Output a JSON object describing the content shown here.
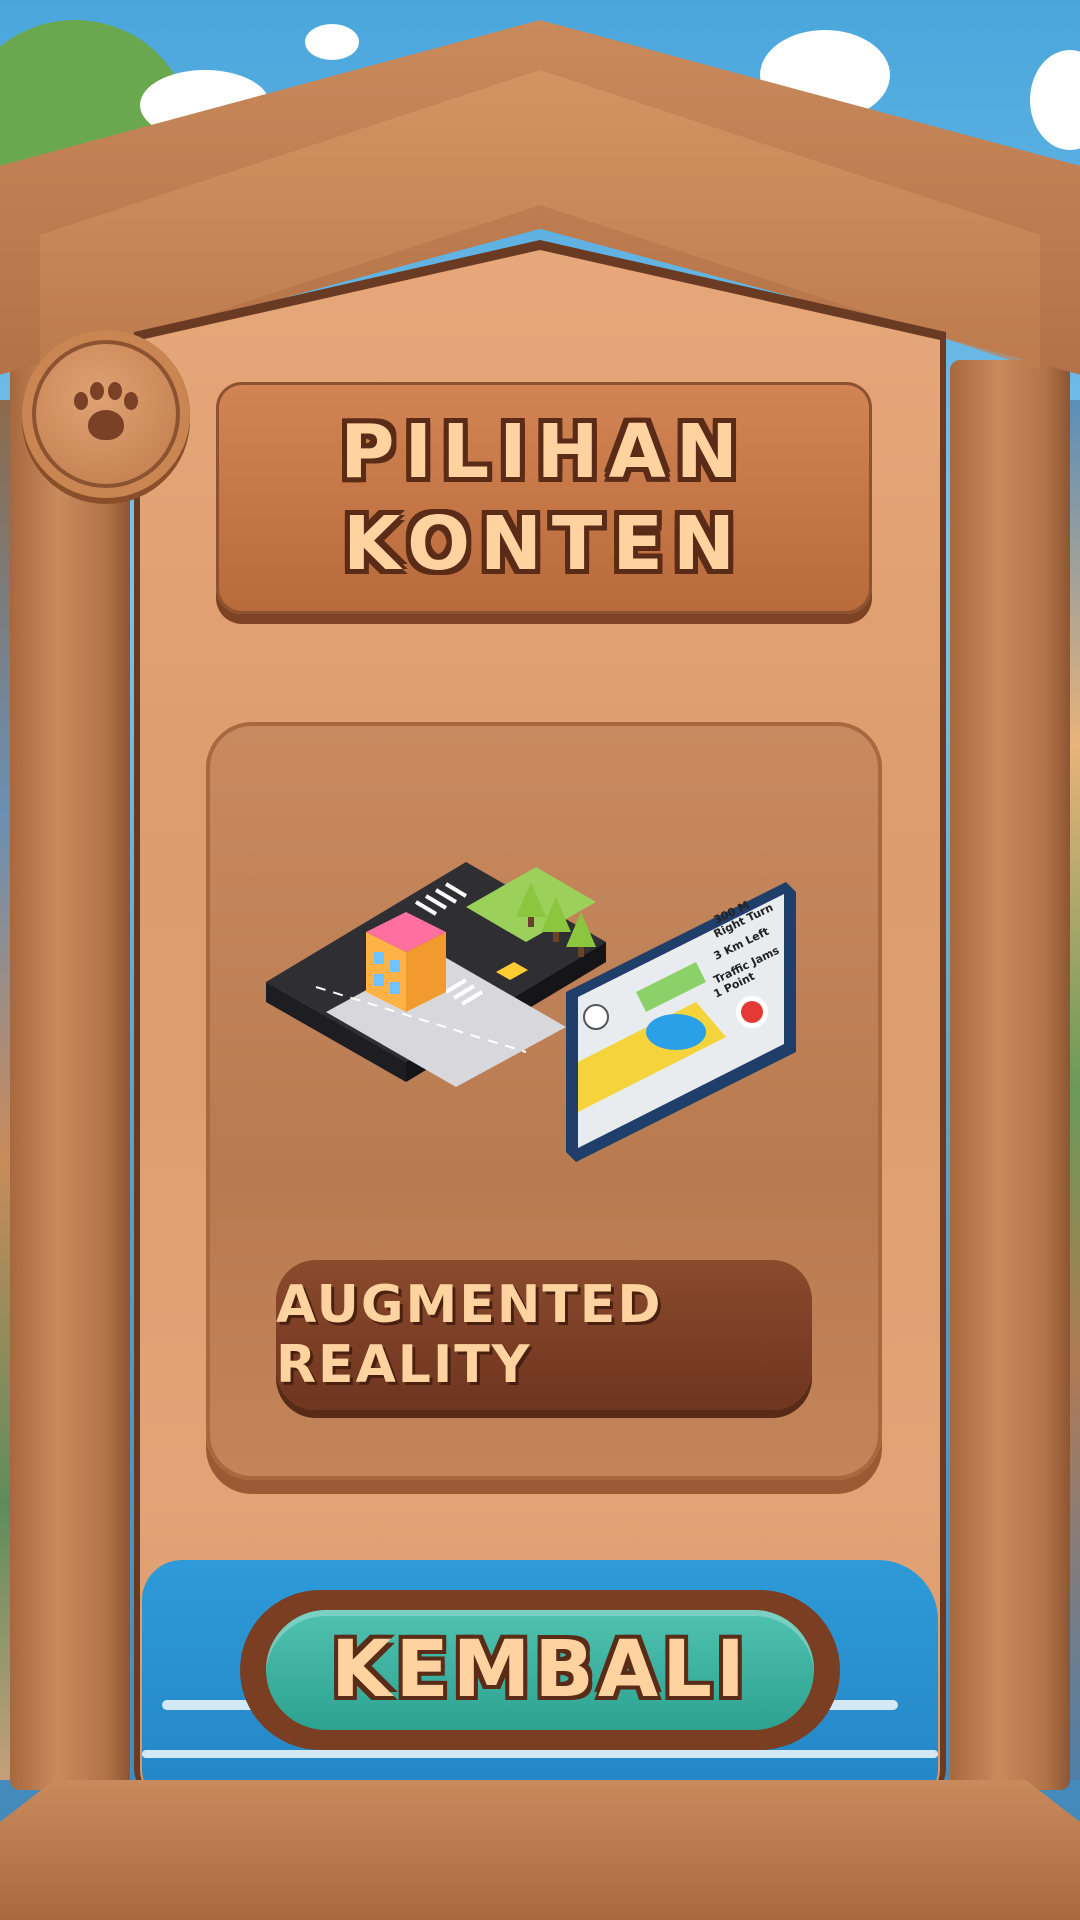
{
  "title": {
    "line1": "PILIHAN",
    "line2": "KONTEN"
  },
  "content_card": {
    "illustration_icon": "augmented-reality-map-icon",
    "button_label": "AUGMENTED REALITY",
    "phone_screen": {
      "line1": "300 M",
      "line2": "Right Turn",
      "line3": "3 Km Left",
      "line4": "Traffic Jams",
      "line5": "1 Point"
    }
  },
  "paw_button": {
    "icon": "paw-icon"
  },
  "back_button": {
    "label": "KEMBALI"
  },
  "colors": {
    "wood": "#dc9c6d",
    "dark_wood": "#6f3520",
    "text_cream": "#ffd3a0",
    "teal": "#2ea290",
    "sky": "#4aa6dc",
    "water": "#2386c6"
  }
}
